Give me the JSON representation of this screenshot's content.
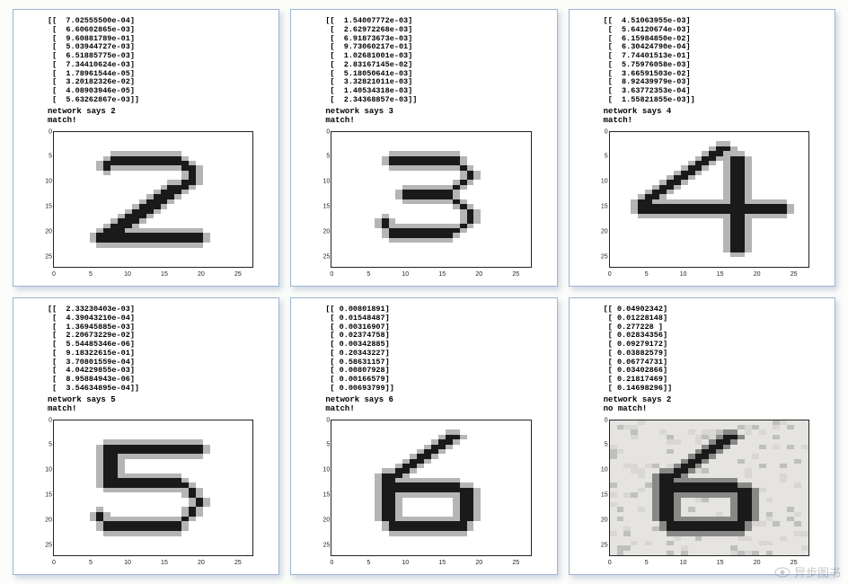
{
  "yticks": [
    0,
    5,
    10,
    15,
    20,
    25
  ],
  "xticks": [
    0,
    5,
    10,
    15,
    20,
    25
  ],
  "panels": [
    {
      "outputs": [
        "[[  7.02555500e-04]",
        " [  6.60602865e-03]",
        " [  9.60881789e-01]",
        " [  5.03944727e-03]",
        " [  6.51885775e-03]",
        " [  7.34410624e-03]",
        " [  1.78961544e-05]",
        " [  3.20182326e-02]",
        " [  4.08903946e-05]",
        " [  5.63262867e-03]]"
      ],
      "network": "network says  2",
      "match": "match!",
      "digit": "2",
      "noisy": false
    },
    {
      "outputs": [
        "[[  1.54007772e-03]",
        " [  2.62972268e-03]",
        " [  6.91873673e-03]",
        " [  9.73060217e-01]",
        " [  1.02681001e-03]",
        " [  2.83167145e-02]",
        " [  5.18050641e-03]",
        " [  3.32821011e-03]",
        " [  1.40534318e-03]",
        " [  2.34368857e-03]]"
      ],
      "network": "network says  3",
      "match": "match!",
      "digit": "3",
      "noisy": false
    },
    {
      "outputs": [
        "[[  4.51063955e-03]",
        " [  5.64120674e-03]",
        " [  6.15984850e-02]",
        " [  6.30424790e-04]",
        " [  7.74401513e-01]",
        " [  5.75976058e-03]",
        " [  3.66591503e-02]",
        " [  8.92439979e-03]",
        " [  3.63772353e-04]",
        " [  1.55821855e-03]]"
      ],
      "network": "network says  4",
      "match": "match!",
      "digit": "4",
      "noisy": false
    },
    {
      "outputs": [
        "[[  2.33230403e-03]",
        " [  4.39043210e-04]",
        " [  1.36945885e-03]",
        " [  2.20673229e-02]",
        " [  5.54485346e-06]",
        " [  9.18322615e-01]",
        " [  3.70801559e-04]",
        " [  4.04229855e-03]",
        " [  8.95884943e-06]",
        " [  3.54634895e-04]]"
      ],
      "network": "network says  5",
      "match": "match!",
      "digit": "5",
      "noisy": false
    },
    {
      "outputs": [
        "[[ 0.00801891]",
        " [ 0.01548487]",
        " [ 0.00316907]",
        " [ 0.02374758]",
        " [ 0.00342885]",
        " [ 0.20343227]",
        " [ 0.58631157]",
        " [ 0.00807928]",
        " [ 0.00166579]",
        " [ 0.00693799]]"
      ],
      "network": "network says  6",
      "match": "match!",
      "digit": "6",
      "noisy": false
    },
    {
      "outputs": [
        "[[ 0.04902342]",
        " [ 0.01228148]",
        " [ 0.277228 ]",
        " [ 0.02834356]",
        " [ 0.09279172]",
        " [ 0.03882579]",
        " [ 0.06774731]",
        " [ 0.03402866]",
        " [ 0.21817469]",
        " [ 0.14698296]]"
      ],
      "network": "network says  2",
      "match": "no match!",
      "digit": "6",
      "noisy": true
    }
  ],
  "watermark": "异步图书"
}
